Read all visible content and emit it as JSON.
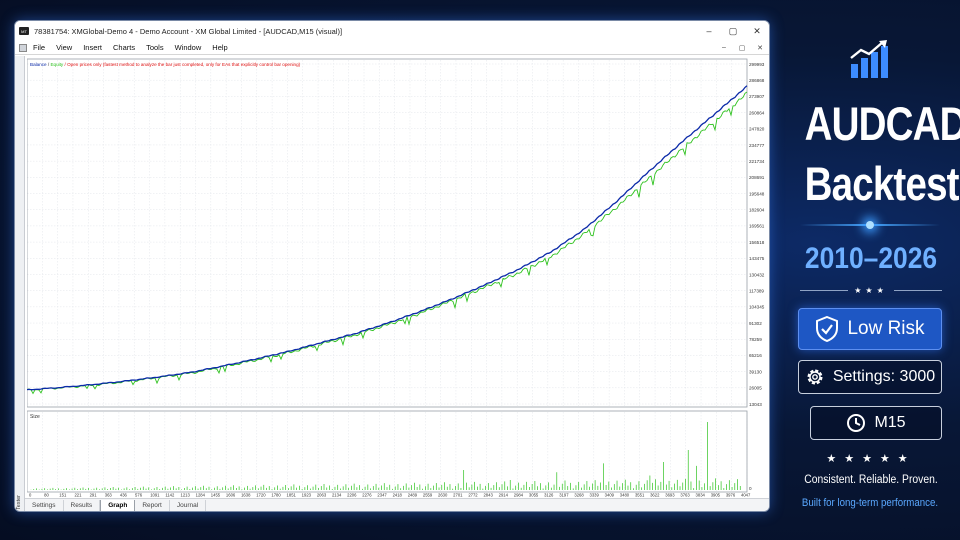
{
  "window": {
    "title": "78381754: XMGlobal-Demo 4 - Demo Account - XM Global Limited - [AUDCAD,M15 (visual)]",
    "controls": [
      "–",
      "▢",
      "✕"
    ],
    "mdi_controls": [
      "–",
      "▢",
      "✕"
    ]
  },
  "menu": [
    "File",
    "View",
    "Insert",
    "Charts",
    "Tools",
    "Window",
    "Help"
  ],
  "chart": {
    "legend_balance": "Balance",
    "legend_sep1": " / ",
    "legend_equity": "Equity",
    "legend_note": " / Open prices only (fastest method to analyze the bar just completed, only for EAs that explicitly control bar opening)",
    "size_label": "Size",
    "side_label": "Tester",
    "colors": {
      "balance": "#0b2aa8",
      "equity": "#2ec21e",
      "note": "#e01010",
      "size_bars": "#2ec21e",
      "grid": "#dfe3e8"
    }
  },
  "tabs": [
    {
      "label": "Settings",
      "active": false
    },
    {
      "label": "Results",
      "active": false
    },
    {
      "label": "Graph",
      "active": true
    },
    {
      "label": "Report",
      "active": false
    },
    {
      "label": "Journal",
      "active": false
    }
  ],
  "chart_data": {
    "type": "line",
    "series": [
      {
        "name": "Balance",
        "values": [
          26005,
          28000,
          30500,
          33500,
          37000,
          41000,
          46500,
          52500,
          59000,
          66500,
          74000,
          83000,
          93000,
          104000,
          116000,
          129000,
          144000,
          163000,
          187000,
          213000,
          238000,
          262000,
          286000
        ]
      },
      {
        "name": "Equity",
        "values": [
          25800,
          27700,
          30000,
          33000,
          36400,
          40300,
          45800,
          51600,
          58000,
          65400,
          72800,
          81600,
          91500,
          102500,
          114000,
          126000,
          140000,
          159000,
          182000,
          207000,
          232000,
          256000,
          280000
        ]
      }
    ],
    "x": [
      0,
      213,
      426,
      639,
      852,
      1065,
      1278,
      1491,
      1704,
      1917,
      2130,
      2343,
      2556,
      2769,
      2982,
      3195,
      3408,
      3621,
      3834,
      4047,
      4260,
      4473,
      4686
    ],
    "y_ticks": [
      "299993",
      "286868",
      "273907",
      "260864",
      "247820",
      "234777",
      "221734",
      "208691",
      "195648",
      "182604",
      "169561",
      "156518",
      "143475",
      "130432",
      "117389",
      "104345",
      "91302",
      "78259",
      "65216",
      "39130",
      "26005",
      "13043"
    ],
    "x_ticks": [
      "0",
      "80",
      "151",
      "221",
      "291",
      "363",
      "436",
      "576",
      "1091",
      "1142",
      "1213",
      "1284",
      "1455",
      "1606",
      "1638",
      "1720",
      "1780",
      "1851",
      "1923",
      "2063",
      "2134",
      "2206",
      "2276",
      "2347",
      "2418",
      "2489",
      "2559",
      "2630",
      "2701",
      "2772",
      "2843",
      "2914",
      "2984",
      "3055",
      "3126",
      "3197",
      "3268",
      "3339",
      "3409",
      "3480",
      "3551",
      "3622",
      "3693",
      "3763",
      "3834",
      "3905",
      "3976",
      "4047"
    ],
    "ylim": [
      13043,
      299993
    ],
    "size_ticks": [
      "0"
    ],
    "grid": true
  },
  "promo": {
    "headline_1": "AUDCAD",
    "headline_2": "Backtest",
    "years": "2010–2026",
    "divider_stars": "★★★",
    "risk_label": "Low Risk",
    "settings_label": "Settings: 3000",
    "timeframe_label": "M15",
    "rating_stars": "★★★★★",
    "tagline": "Consistent. Reliable. Proven.",
    "subtagline": "Built for long-term performance.",
    "accent": "#1e57c4",
    "highlight": "#6fb0ff",
    "icons": [
      "bar-chart-growth-icon",
      "shield-check-icon",
      "gear-icon",
      "clock-icon"
    ]
  }
}
